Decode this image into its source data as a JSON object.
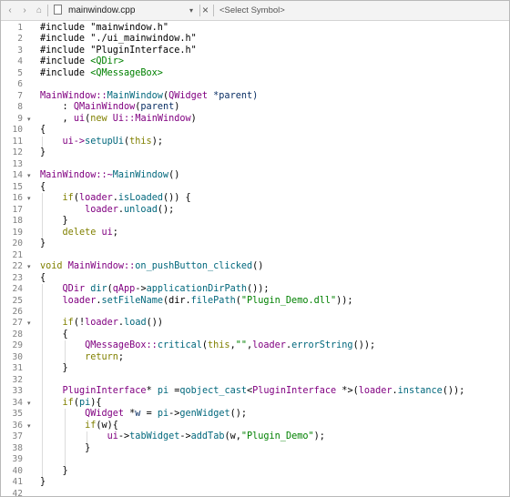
{
  "toolbar": {
    "back_glyph": "‹",
    "forward_glyph": "›",
    "lock_glyph": "⌂",
    "dropdown_glyph": "▾",
    "close_glyph": "×",
    "file_tab": "mainwindow.cpp",
    "symbol_selector": "<Select Symbol>"
  },
  "editor": {
    "fold_glyph": "▾",
    "lines": [
      {
        "n": "1",
        "segs": [
          {
            "t": "#include \"mainwindow.h\"",
            "c": "plain"
          }
        ]
      },
      {
        "n": "2",
        "segs": [
          {
            "t": "#include \"./ui_mainwindow.h\"",
            "c": "plain"
          }
        ]
      },
      {
        "n": "3",
        "segs": [
          {
            "t": "#include \"PluginInterface.h\"",
            "c": "plain"
          }
        ]
      },
      {
        "n": "4",
        "segs": [
          {
            "t": "#include ",
            "c": "plain"
          },
          {
            "t": "<QDir>",
            "c": "st"
          }
        ]
      },
      {
        "n": "5",
        "segs": [
          {
            "t": "#include ",
            "c": "plain"
          },
          {
            "t": "<QMessageBox>",
            "c": "st"
          }
        ]
      },
      {
        "n": "6",
        "segs": []
      },
      {
        "n": "7",
        "segs": [
          {
            "t": "MainWindow::",
            "c": "cl"
          },
          {
            "t": "MainWindow",
            "c": "fn"
          },
          {
            "t": "(",
            "c": "plain"
          },
          {
            "t": "QWidget",
            "c": "cl"
          },
          {
            "t": " *parent)",
            "c": "pa"
          }
        ]
      },
      {
        "n": "8",
        "segs": [
          {
            "t": "    : ",
            "c": "plain"
          },
          {
            "t": "QMainWindow",
            "c": "cl"
          },
          {
            "t": "(",
            "c": "plain"
          },
          {
            "t": "parent",
            "c": "pa"
          },
          {
            "t": ")",
            "c": "plain"
          }
        ]
      },
      {
        "n": "9",
        "fold": true,
        "segs": [
          {
            "t": "    , ",
            "c": "plain"
          },
          {
            "t": "ui",
            "c": "cl"
          },
          {
            "t": "(",
            "c": "plain"
          },
          {
            "t": "new",
            "c": "kw"
          },
          {
            "t": " ",
            "c": "plain"
          },
          {
            "t": "Ui::MainWindow",
            "c": "cl"
          },
          {
            "t": ")",
            "c": "plain"
          }
        ]
      },
      {
        "n": "10",
        "segs": [
          {
            "t": "{",
            "c": "plain"
          }
        ]
      },
      {
        "n": "11",
        "segs": [
          {
            "t": "    ui->",
            "c": "cl"
          },
          {
            "t": "setupUi",
            "c": "fn"
          },
          {
            "t": "(",
            "c": "plain"
          },
          {
            "t": "this",
            "c": "kw"
          },
          {
            "t": ");",
            "c": "plain"
          }
        ]
      },
      {
        "n": "12",
        "segs": [
          {
            "t": "}",
            "c": "plain"
          }
        ]
      },
      {
        "n": "13",
        "segs": []
      },
      {
        "n": "14",
        "fold": true,
        "segs": [
          {
            "t": "MainWindow::~",
            "c": "cl"
          },
          {
            "t": "MainWindow",
            "c": "fn"
          },
          {
            "t": "()",
            "c": "plain"
          }
        ]
      },
      {
        "n": "15",
        "segs": [
          {
            "t": "{",
            "c": "plain"
          }
        ]
      },
      {
        "n": "16",
        "fold": true,
        "segs": [
          {
            "t": "    ",
            "c": "plain"
          },
          {
            "t": "if",
            "c": "kw"
          },
          {
            "t": "(",
            "c": "plain"
          },
          {
            "t": "loader",
            "c": "cl"
          },
          {
            "t": ".",
            "c": "plain"
          },
          {
            "t": "isLoaded",
            "c": "fn"
          },
          {
            "t": "()) {",
            "c": "plain"
          }
        ]
      },
      {
        "n": "17",
        "segs": [
          {
            "t": "        ",
            "c": "plain"
          },
          {
            "t": "loader",
            "c": "cl"
          },
          {
            "t": ".",
            "c": "plain"
          },
          {
            "t": "unload",
            "c": "fn"
          },
          {
            "t": "();",
            "c": "plain"
          }
        ]
      },
      {
        "n": "18",
        "segs": [
          {
            "t": "    }",
            "c": "plain"
          }
        ]
      },
      {
        "n": "19",
        "segs": [
          {
            "t": "    ",
            "c": "plain"
          },
          {
            "t": "delete",
            "c": "kw"
          },
          {
            "t": " ",
            "c": "plain"
          },
          {
            "t": "ui",
            "c": "cl"
          },
          {
            "t": ";",
            "c": "plain"
          }
        ]
      },
      {
        "n": "20",
        "segs": [
          {
            "t": "}",
            "c": "plain"
          }
        ]
      },
      {
        "n": "21",
        "segs": []
      },
      {
        "n": "22",
        "fold": true,
        "segs": [
          {
            "t": "void",
            "c": "kw"
          },
          {
            "t": " ",
            "c": "plain"
          },
          {
            "t": "MainWindow::",
            "c": "cl"
          },
          {
            "t": "on_pushButton_clicked",
            "c": "fn"
          },
          {
            "t": "()",
            "c": "plain"
          }
        ]
      },
      {
        "n": "23",
        "segs": [
          {
            "t": "{",
            "c": "plain"
          }
        ]
      },
      {
        "n": "24",
        "segs": [
          {
            "t": "    ",
            "c": "plain"
          },
          {
            "t": "QDir",
            "c": "cl"
          },
          {
            "t": " ",
            "c": "plain"
          },
          {
            "t": "dir",
            "c": "fn"
          },
          {
            "t": "(",
            "c": "plain"
          },
          {
            "t": "qApp",
            "c": "cl"
          },
          {
            "t": "->",
            "c": "plain"
          },
          {
            "t": "applicationDirPath",
            "c": "fn"
          },
          {
            "t": "());",
            "c": "plain"
          }
        ]
      },
      {
        "n": "25",
        "segs": [
          {
            "t": "    ",
            "c": "plain"
          },
          {
            "t": "loader",
            "c": "cl"
          },
          {
            "t": ".",
            "c": "plain"
          },
          {
            "t": "setFileName",
            "c": "fn"
          },
          {
            "t": "(dir.",
            "c": "plain"
          },
          {
            "t": "filePath",
            "c": "fn"
          },
          {
            "t": "(",
            "c": "plain"
          },
          {
            "t": "\"Plugin_Demo.dll\"",
            "c": "st"
          },
          {
            "t": "));",
            "c": "plain"
          }
        ]
      },
      {
        "n": "26",
        "segs": []
      },
      {
        "n": "27",
        "fold": true,
        "segs": [
          {
            "t": "    ",
            "c": "plain"
          },
          {
            "t": "if",
            "c": "kw"
          },
          {
            "t": "(!",
            "c": "plain"
          },
          {
            "t": "loader",
            "c": "cl"
          },
          {
            "t": ".",
            "c": "plain"
          },
          {
            "t": "load",
            "c": "fn"
          },
          {
            "t": "())",
            "c": "plain"
          }
        ]
      },
      {
        "n": "28",
        "segs": [
          {
            "t": "    {",
            "c": "plain"
          }
        ]
      },
      {
        "n": "29",
        "segs": [
          {
            "t": "        ",
            "c": "plain"
          },
          {
            "t": "QMessageBox::",
            "c": "cl"
          },
          {
            "t": "critical",
            "c": "fn"
          },
          {
            "t": "(",
            "c": "plain"
          },
          {
            "t": "this",
            "c": "kw"
          },
          {
            "t": ",",
            "c": "plain"
          },
          {
            "t": "\"\"",
            "c": "st"
          },
          {
            "t": ",",
            "c": "plain"
          },
          {
            "t": "loader",
            "c": "cl"
          },
          {
            "t": ".",
            "c": "plain"
          },
          {
            "t": "errorString",
            "c": "fn"
          },
          {
            "t": "());",
            "c": "plain"
          }
        ]
      },
      {
        "n": "30",
        "segs": [
          {
            "t": "        ",
            "c": "plain"
          },
          {
            "t": "return",
            "c": "kw"
          },
          {
            "t": ";",
            "c": "plain"
          }
        ]
      },
      {
        "n": "31",
        "segs": [
          {
            "t": "    }",
            "c": "plain"
          }
        ]
      },
      {
        "n": "32",
        "segs": []
      },
      {
        "n": "33",
        "segs": [
          {
            "t": "    ",
            "c": "plain"
          },
          {
            "t": "PluginInterface",
            "c": "cl"
          },
          {
            "t": "* ",
            "c": "plain"
          },
          {
            "t": "pi",
            "c": "fn"
          },
          {
            "t": " =",
            "c": "plain"
          },
          {
            "t": "qobject_cast",
            "c": "fn"
          },
          {
            "t": "<",
            "c": "plain"
          },
          {
            "t": "PluginInterface",
            "c": "cl"
          },
          {
            "t": " *>(",
            "c": "plain"
          },
          {
            "t": "loader",
            "c": "cl"
          },
          {
            "t": ".",
            "c": "plain"
          },
          {
            "t": "instance",
            "c": "fn"
          },
          {
            "t": "());",
            "c": "plain"
          }
        ]
      },
      {
        "n": "34",
        "fold": true,
        "segs": [
          {
            "t": "    ",
            "c": "plain"
          },
          {
            "t": "if",
            "c": "kw"
          },
          {
            "t": "(",
            "c": "plain"
          },
          {
            "t": "pi",
            "c": "fn"
          },
          {
            "t": "){",
            "c": "plain"
          }
        ]
      },
      {
        "n": "35",
        "segs": [
          {
            "t": "        ",
            "c": "plain"
          },
          {
            "t": "QWidget",
            "c": "cl"
          },
          {
            "t": " *",
            "c": "plain"
          },
          {
            "t": "w",
            "c": "pa"
          },
          {
            "t": " = ",
            "c": "plain"
          },
          {
            "t": "pi",
            "c": "fn"
          },
          {
            "t": "->",
            "c": "plain"
          },
          {
            "t": "genWidget",
            "c": "fn"
          },
          {
            "t": "();",
            "c": "plain"
          }
        ]
      },
      {
        "n": "36",
        "fold": true,
        "segs": [
          {
            "t": "        ",
            "c": "plain"
          },
          {
            "t": "if",
            "c": "kw"
          },
          {
            "t": "(w){",
            "c": "plain"
          }
        ]
      },
      {
        "n": "37",
        "segs": [
          {
            "t": "            ",
            "c": "plain"
          },
          {
            "t": "ui",
            "c": "cl"
          },
          {
            "t": "->",
            "c": "plain"
          },
          {
            "t": "tabWidget",
            "c": "fn"
          },
          {
            "t": "->",
            "c": "plain"
          },
          {
            "t": "addTab",
            "c": "fn"
          },
          {
            "t": "(w,",
            "c": "plain"
          },
          {
            "t": "\"Plugin_Demo\"",
            "c": "st"
          },
          {
            "t": ");",
            "c": "plain"
          }
        ]
      },
      {
        "n": "38",
        "segs": [
          {
            "t": "        }",
            "c": "plain"
          }
        ]
      },
      {
        "n": "39",
        "segs": []
      },
      {
        "n": "40",
        "segs": [
          {
            "t": "    }",
            "c": "plain"
          }
        ]
      },
      {
        "n": "41",
        "segs": [
          {
            "t": "}",
            "c": "plain"
          }
        ]
      },
      {
        "n": "42",
        "segs": []
      }
    ]
  }
}
